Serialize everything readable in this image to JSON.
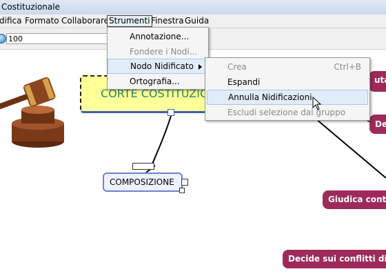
{
  "window": {
    "title": "Costituzionale"
  },
  "menubar": {
    "items": [
      {
        "label": "difica"
      },
      {
        "label": "Formato"
      },
      {
        "label": "Collaborare"
      },
      {
        "label": "Strumenti"
      },
      {
        "label": "Finestra"
      },
      {
        "label": "Guida"
      }
    ]
  },
  "toolbar": {
    "zoom_value": "100",
    "zoom_icon": "zoom-icon"
  },
  "strumenti_menu": {
    "items": [
      {
        "label": "Annotazione...",
        "enabled": true
      },
      {
        "label": "Fondere i Nodi...",
        "enabled": false
      },
      {
        "label": "Nodo Nidificato",
        "enabled": true,
        "has_submenu": true
      },
      {
        "label": "Ortografia...",
        "enabled": true
      }
    ]
  },
  "nidificato_submenu": {
    "items": [
      {
        "label": "Crea",
        "shortcut": "Ctrl+B",
        "enabled": false
      },
      {
        "label": "Espandi",
        "enabled": true
      },
      {
        "label": "Annulla Nidificazioni",
        "enabled": true,
        "highlighted": true
      },
      {
        "label": "Escludi selezione dal gruppo",
        "enabled": false
      }
    ]
  },
  "canvas": {
    "nodes": {
      "main": "CORTE COSTITUZIONALE",
      "composition": "COMPOSIZIONE",
      "maroon_1": "uta",
      "maroon_2": "De",
      "maroon_3": "Giudica cont",
      "maroon_4": "Decide sui conflitti di"
    },
    "colors": {
      "maroon": "#9e2a5c",
      "main_fill": "#ffff99",
      "main_text": "#2e8b57",
      "blue_border": "#6b82d6"
    }
  }
}
